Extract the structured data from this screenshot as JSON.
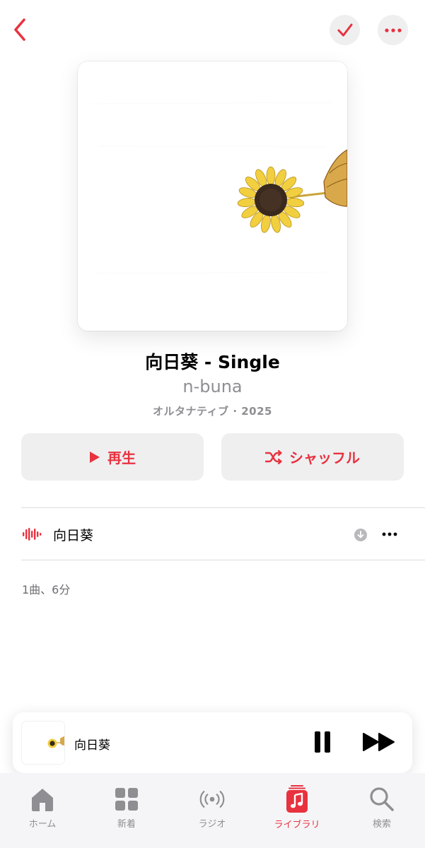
{
  "header": {
    "back_icon": "chevron-left-icon",
    "check_icon": "checkmark-icon",
    "more_icon": "ellipsis-icon"
  },
  "album": {
    "title": "向日葵 - Single",
    "artist": "n-buna",
    "meta": "オルタナティブ · 2025"
  },
  "actions": {
    "play_label": "再生",
    "shuffle_label": "シャッフル"
  },
  "tracks": [
    {
      "title": "向日葵",
      "playing_icon": "waveform-icon",
      "download_icon": "download-icon",
      "more_icon": "ellipsis-icon"
    }
  ],
  "summary": "1曲、6分",
  "mini_player": {
    "title": "向日葵",
    "pause_icon": "pause-icon",
    "next_icon": "forward-icon"
  },
  "tabs": [
    {
      "label": "ホーム",
      "icon": "home-icon",
      "active": false
    },
    {
      "label": "新着",
      "icon": "grid-icon",
      "active": false
    },
    {
      "label": "ラジオ",
      "icon": "radio-icon",
      "active": false
    },
    {
      "label": "ライブラリ",
      "icon": "library-icon",
      "active": true
    },
    {
      "label": "検索",
      "icon": "search-icon",
      "active": false
    }
  ],
  "colors": {
    "accent": "#e8323f",
    "secondary_text": "#8e8e93",
    "button_bg": "#efeff0",
    "tab_bar_bg": "#f5f5f7"
  }
}
